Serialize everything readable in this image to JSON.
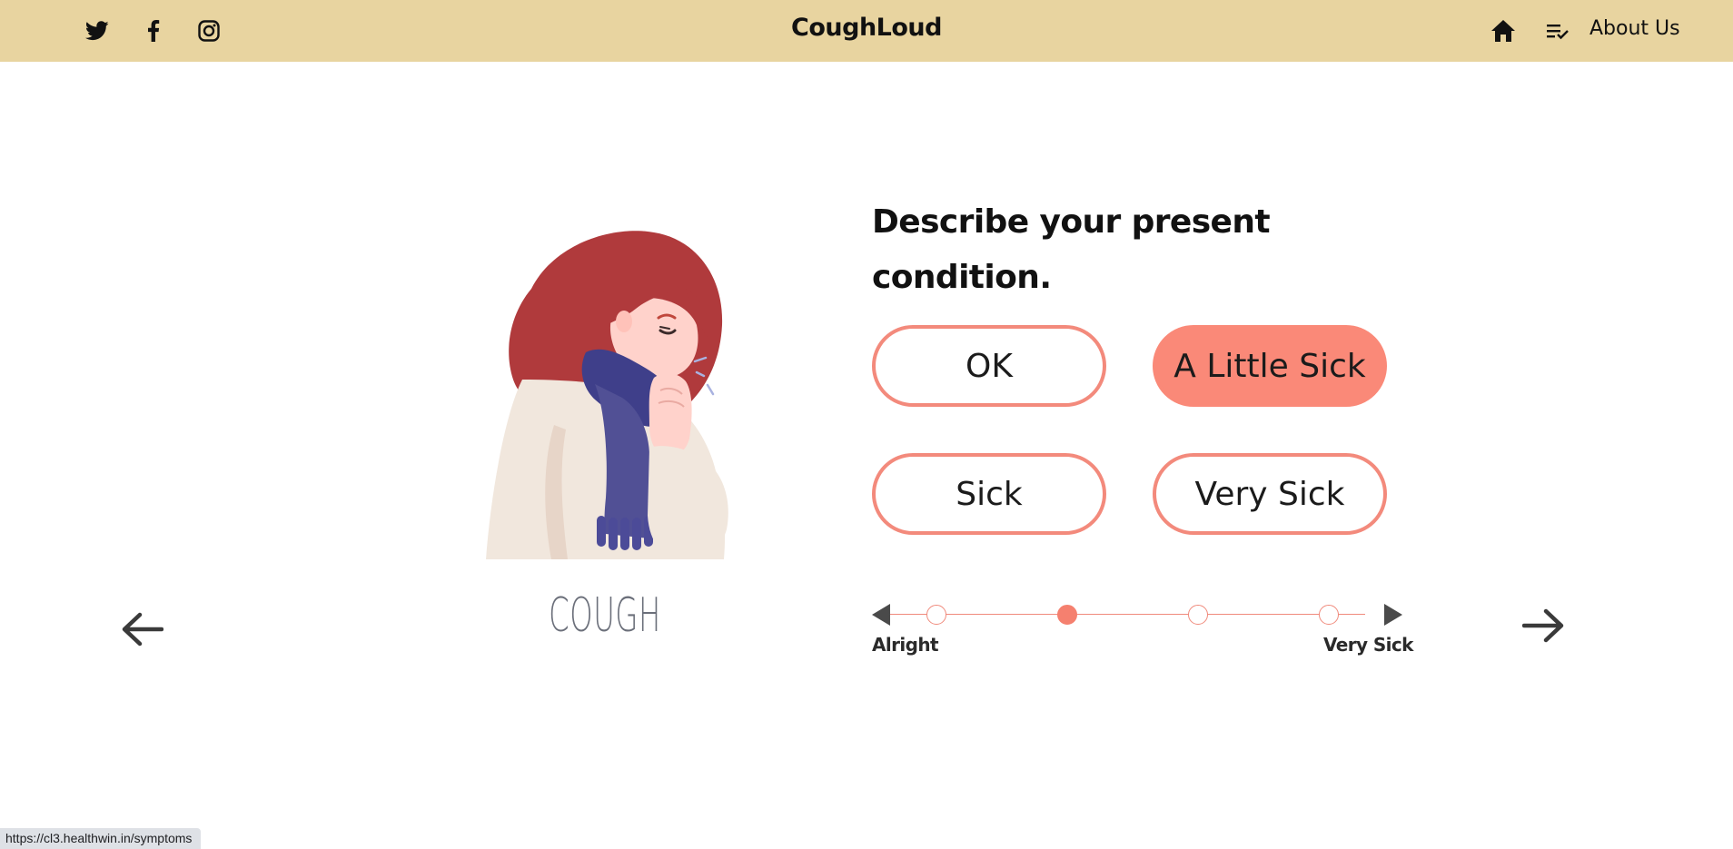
{
  "header": {
    "brand": "CoughLoud",
    "social_icons": [
      "twitter-icon",
      "facebook-icon",
      "instagram-icon"
    ],
    "nav": {
      "home_icon": "home-icon",
      "list_icon": "list-check-icon",
      "about_label": "About Us"
    }
  },
  "card": {
    "illustration": "woman-coughing-illustration",
    "caption": "COUGH"
  },
  "question": {
    "title": "Describe your present condition.",
    "options": [
      {
        "label": "OK",
        "selected": false
      },
      {
        "label": "A Little Sick",
        "selected": true
      },
      {
        "label": "Sick",
        "selected": false
      },
      {
        "label": "Very Sick",
        "selected": false
      }
    ]
  },
  "scale": {
    "min_label": "Alright",
    "max_label": "Very Sick",
    "steps": 4,
    "selected_step": 2
  },
  "navigation": {
    "prev_icon": "arrow-left-icon",
    "next_icon": "arrow-right-icon"
  },
  "status_bar": {
    "url": "https://cl3.healthwin.in/symptoms"
  },
  "colors": {
    "header_bg": "#e8d4a0",
    "accent": "#fa8978",
    "accent_border": "#f38a7c",
    "scale_arrow": "#4a4a4a"
  }
}
